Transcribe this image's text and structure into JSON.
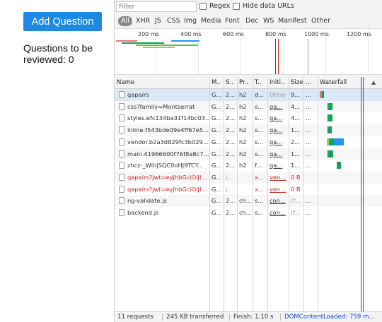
{
  "app": {
    "add_question_label": "Add Question",
    "questions_review_text": "Questions to be reviewed: 0"
  },
  "devtools": {
    "filter_placeholder": "Filter",
    "regex_label": "Regex",
    "hide_data_urls_label": "Hide data URLs",
    "type_filters": [
      "All",
      "XHR",
      "JS",
      "CSS",
      "Img",
      "Media",
      "Font",
      "Doc",
      "WS",
      "Manifest",
      "Other"
    ],
    "active_filter": "All",
    "timeline_ticks": [
      "200 ms",
      "400 ms",
      "600 ms",
      "800 ms",
      "1000 ms",
      "1200 ms"
    ],
    "columns": {
      "name": "Name",
      "method": "M..",
      "status": "S..",
      "protocol": "Pr..",
      "type": "T..",
      "initiator": "Initi..",
      "size": "Size",
      "time": "...",
      "waterfall": "Waterfall"
    },
    "requests": [
      {
        "name": "qapairs",
        "method": "G...",
        "status": "2...",
        "protocol": "h2",
        "type": "d...",
        "initiator": "Other",
        "size": "9...",
        "time": "...",
        "style": "selected"
      },
      {
        "name": "css?family=Montserrat",
        "method": "G...",
        "status": "2...",
        "protocol": "h2",
        "type": "s...",
        "initiator": "qa...",
        "size": "4...",
        "time": "...",
        "style": "normal"
      },
      {
        "name": "styles.efc134ba31f14bc03...",
        "method": "G...",
        "status": "2...",
        "protocol": "h2",
        "type": "s...",
        "initiator": "qa...",
        "size": "4...",
        "time": "...",
        "style": "normal"
      },
      {
        "name": "inline.f543bde09e4ff67e5...",
        "method": "G...",
        "status": "2...",
        "protocol": "h2",
        "type": "s...",
        "initiator": "qa...",
        "size": "1...",
        "time": "...",
        "style": "normal"
      },
      {
        "name": "vendor.b2a3d829fc3b029...",
        "method": "G...",
        "status": "2...",
        "protocol": "h2",
        "type": "s...",
        "initiator": "qa...",
        "size": "2...",
        "time": "...",
        "style": "normal"
      },
      {
        "name": "main.41966600f76f8a8c7...",
        "method": "G...",
        "status": "2...",
        "protocol": "h2",
        "type": "s...",
        "initiator": "qa...",
        "size": "1...",
        "time": "...",
        "style": "normal"
      },
      {
        "name": "zhcz-_WihjSQC0oHJ9TCY...",
        "method": "G...",
        "status": "2...",
        "protocol": "h2",
        "type": "f...",
        "initiator": "qa...",
        "size": "1...",
        "time": "...",
        "style": "normal"
      },
      {
        "name": "qapairs?jwt=eyJhbGciOiJI...",
        "method": "G...",
        "status": "(...",
        "protocol": "",
        "type": "x...",
        "initiator": "ven...",
        "size": "0 B",
        "time": "",
        "style": "error"
      },
      {
        "name": "qapairs?jwt=eyJhbGciOiJI...",
        "method": "G...",
        "status": "(...",
        "protocol": "",
        "type": "x...",
        "initiator": "ven...",
        "size": "0 B",
        "time": "",
        "style": "error"
      },
      {
        "name": "ng-validate.js",
        "method": "G...",
        "status": "2...",
        "protocol": "ch...",
        "type": "s...",
        "initiator": "con...",
        "size": "(f...",
        "time": "...",
        "style": "normal"
      },
      {
        "name": "backend.js",
        "method": "G...",
        "status": "2...",
        "protocol": "ch...",
        "type": "s...",
        "initiator": "con...",
        "size": "(f...",
        "time": "...",
        "style": "normal"
      }
    ],
    "status": {
      "requests": "11 requests",
      "transferred": "245 KB transferred",
      "finish": "Finish: 1.10 s",
      "dom_content_loaded": "DOMContentLoaded: 759 m..."
    },
    "colors": {
      "dom_content_loaded": "#1a46d6",
      "load_event": "#c62828",
      "error_text": "#c62828",
      "waterfall_waiting": "#14a05a",
      "waterfall_download": "#2196f3"
    }
  }
}
